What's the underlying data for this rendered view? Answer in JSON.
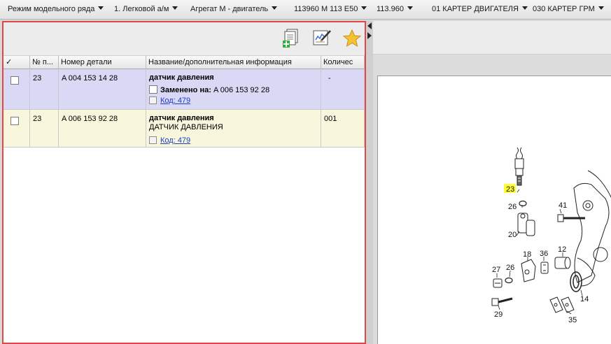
{
  "breadcrumb": {
    "items": [
      {
        "label": "Режим модельного ряда"
      },
      {
        "label": "1. Легковой а/м"
      },
      {
        "label": "Агрегат М  - двигатель"
      },
      {
        "label": "113960 M 113 E50"
      },
      {
        "label": "113.960"
      },
      {
        "label": "01 КАРТЕР ДВИГАТЕЛЯ"
      },
      {
        "label": "030 КАРТЕР ГРМ"
      }
    ]
  },
  "toolbar": {
    "icons": [
      "add-to-list-icon",
      "edit-notes-icon",
      "favorite-star-icon"
    ]
  },
  "table": {
    "headers": {
      "check": "✓",
      "pos": "№ п...",
      "part": "Номер детали",
      "name": "Название/дополнительная информация",
      "qty": "Количес"
    },
    "rows": [
      {
        "pos": "23",
        "part": "A 004 153 14 28",
        "name": "датчик давления",
        "replaced_label": "Заменено на:",
        "replaced_value": "A 006 153 92 28",
        "code": "Код: 479",
        "qty": "-"
      },
      {
        "pos": "23",
        "part": "A 006 153 92 28",
        "name": "датчик давления",
        "subname": "ДАТЧИК ДАВЛЕНИЯ",
        "code": "Код: 479",
        "qty": "001"
      }
    ]
  },
  "drawing": {
    "callouts": [
      "23",
      "26",
      "41",
      "20",
      "18",
      "36",
      "12",
      "27",
      "26",
      "14",
      "29",
      "35"
    ],
    "highlight_color": "#ffff33"
  }
}
